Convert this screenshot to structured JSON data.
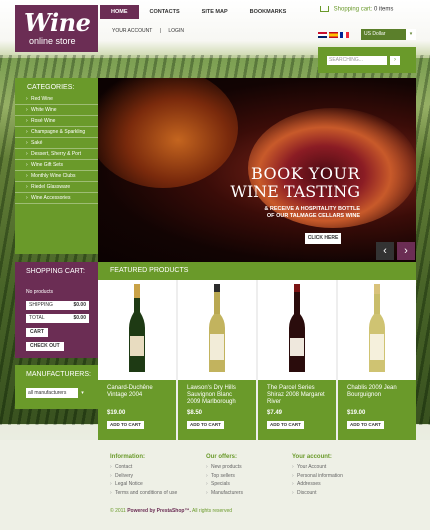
{
  "brand": {
    "title": "Wine",
    "subtitle": "online store"
  },
  "topnav": [
    "HOME",
    "CONTACTS",
    "SITE MAP",
    "BOOKMARKS"
  ],
  "subnav": {
    "account": "YOUR ACCOUNT",
    "separator": "|",
    "login": "LOGIN"
  },
  "cart_header": {
    "label": "Shopping cart:",
    "count": "0 items"
  },
  "currency": {
    "value": "US Dollar",
    "arrow": "▾"
  },
  "search": {
    "placeholder": "SEARCHING...",
    "button": "›"
  },
  "categories": {
    "title": "CATEGORIES:",
    "items": [
      "Red Wine",
      "White Wine",
      "Rosé Wine",
      "Champagne & Sparkling",
      "Saké",
      "Dessert, Sherry & Port",
      "Wine Gift Sets",
      "Monthly Wine Clubs",
      "Riedel Glassware",
      "Wine Accessories"
    ]
  },
  "banner": {
    "line1": "BOOK YOUR",
    "line2": "WINE TASTING",
    "line3": "& RECEIVE A HOSPITALITY BOTTLE",
    "line4": "OF OUR TALMAGE CELLARS WINE",
    "button": "CLICK HERE",
    "prev": "‹",
    "next": "›"
  },
  "shopping_cart": {
    "title": "SHOPPING CART:",
    "empty": "No products",
    "shipping_label": "SHIPPING",
    "shipping_value": "$0.00",
    "total_label": "TOTAL",
    "total_value": "$0.00",
    "cart_button": "CART",
    "checkout_button": "CHECK OUT"
  },
  "manufacturers": {
    "title": "MANUFACTURERS:",
    "selected": "all manufacturers",
    "arrow": "▾"
  },
  "featured": {
    "title": "FEATURED PRODUCTS",
    "products": [
      {
        "name": "Canard-Duchêne Vintage 2004",
        "price": "$19.00",
        "button": "ADD TO CART",
        "color": "#1e3a14",
        "label": "#e8dcc0"
      },
      {
        "name": "Lawson's Dry Hills Sauvignon Blanc 2009 Marlborough",
        "price": "$8.50",
        "button": "ADD TO CART",
        "color": "#b9a852",
        "label": "#f2ecd8"
      },
      {
        "name": "The Parcel Series Shiraz 2008 Margaret River",
        "price": "$7.49",
        "button": "ADD TO CART",
        "color": "#2a0c0c",
        "label": "#efe8dd"
      },
      {
        "name": "Chablis 2009 Jean Bourguignon",
        "price": "$19.00",
        "button": "ADD TO CART",
        "color": "#c9bd6a",
        "label": "#f5f0dc"
      }
    ]
  },
  "footer": {
    "info": {
      "title": "Information:",
      "items": [
        "Contact",
        "Delivery",
        "Legal Notice",
        "Terms and conditions of use"
      ]
    },
    "offers": {
      "title": "Our offers:",
      "items": [
        "New products",
        "Top sellers",
        "Specials",
        "Manufacturers"
      ]
    },
    "account": {
      "title": "Your account:",
      "items": [
        "Your Account",
        "Personal information",
        "Addresses",
        "Discount"
      ]
    },
    "copyright_year": "© 2011",
    "copyright_brand": "Powered by PrestaShop™.",
    "copyright_rest": "All rights reserved"
  }
}
